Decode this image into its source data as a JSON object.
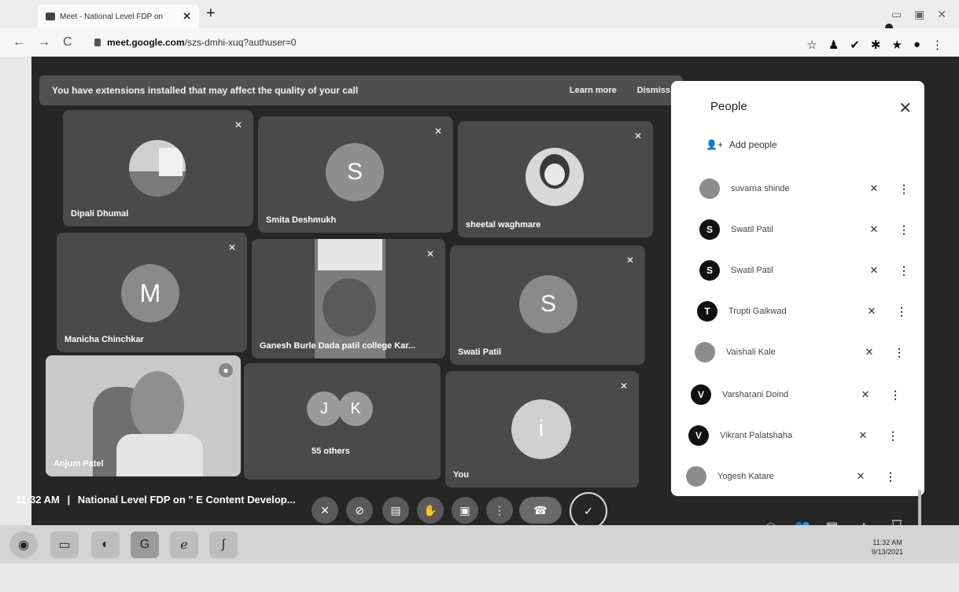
{
  "browser": {
    "tab_title": "Meet - National Level FDP on",
    "new_tab": "+",
    "url_host": "meet.google.com",
    "url_path": "/szs-dmhi-xuq?authuser=0"
  },
  "banner": {
    "message": "You have extensions installed that may affect the quality of your call",
    "learn_more": "Learn more",
    "dismiss": "Dismiss"
  },
  "tiles": [
    {
      "name": "Dipali Dhumal"
    },
    {
      "name": "Smita Deshmukh",
      "initial": "S"
    },
    {
      "name": "sheetal waghmare"
    },
    {
      "name": "Manicha Chinchkar",
      "initial": "M"
    },
    {
      "name": "Ganesh Burle Dada patil college Kar..."
    },
    {
      "name": "Swati Patil",
      "initial": "S"
    },
    {
      "name": "Anjum Patel"
    },
    {
      "name": "55 others",
      "initial_1": "J",
      "initial_2": "K"
    },
    {
      "name": "You",
      "initial": "i"
    }
  ],
  "bottom": {
    "time": "11:32 AM",
    "separator": "|",
    "meeting_title": "National Level FDP on \" E Content Develop..."
  },
  "people": {
    "title": "People",
    "add_people": "Add people",
    "list": [
      {
        "name": "suvarna shinde",
        "initial": ""
      },
      {
        "name": "Swatil Patil",
        "initial": "S"
      },
      {
        "name": "Swatil Patil",
        "initial": "S"
      },
      {
        "name": "Trupti Gaikwad",
        "initial": "T"
      },
      {
        "name": "Vaishali Kale",
        "initial": ""
      },
      {
        "name": "Varsharani Doind",
        "initial": "V"
      },
      {
        "name": "Vikrant Palatshaha",
        "initial": "V"
      },
      {
        "name": "Yogesh Katare",
        "initial": ""
      }
    ]
  },
  "taskbar": {
    "time": "11:32 AM",
    "date": "9/13/2021"
  }
}
